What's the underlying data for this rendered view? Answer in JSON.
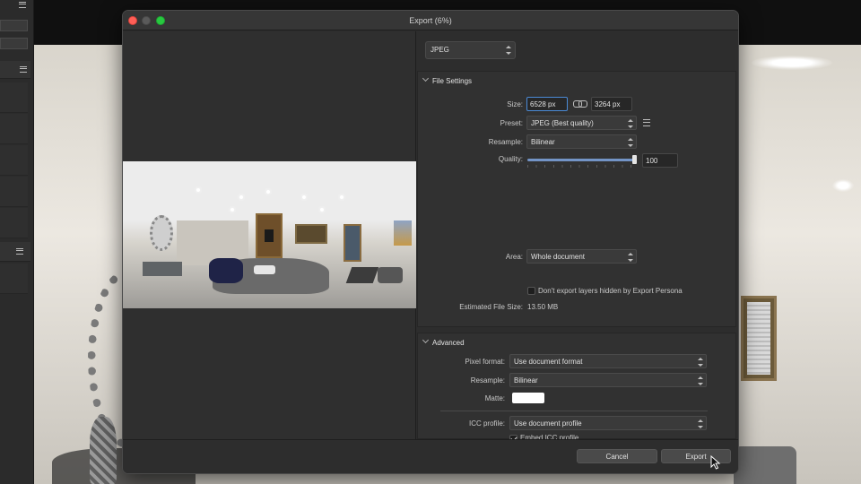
{
  "dialog": {
    "title": "Export (6%)",
    "format": {
      "value": "JPEG"
    }
  },
  "file_settings": {
    "header": "File Settings",
    "size_label": "Size:",
    "width_value": "6528 px",
    "height_value": "3264 px",
    "preset_label": "Preset:",
    "preset_value": "JPEG (Best quality)",
    "resample_label": "Resample:",
    "resample_value": "Bilinear",
    "quality_label": "Quality:",
    "quality_value": "100",
    "quality_level": 1.0,
    "area_label": "Area:",
    "area_value": "Whole document",
    "hidden_layers_label": "Don't export layers hidden by Export Persona",
    "estimated_label": "Estimated File Size:",
    "estimated_value": "13.50 MB"
  },
  "advanced": {
    "header": "Advanced",
    "pixel_format_label": "Pixel format:",
    "pixel_format_value": "Use document format",
    "resample_label": "Resample:",
    "resample_value": "Bilinear",
    "matte_label": "Matte:",
    "matte_color": "#ffffff",
    "icc_label": "ICC profile:",
    "icc_value": "Use document profile",
    "embed_icc_label": "Embed ICC profile"
  },
  "footer": {
    "cancel_label": "Cancel",
    "export_label": "Export"
  },
  "colors": {
    "accent": "#4b8ad6",
    "slider_fill": "#7394c6",
    "close": "#ff5f57",
    "maximize": "#28c840"
  },
  "icons": [
    "menu-icon",
    "link-icon",
    "chevron-down-icon",
    "list-icon",
    "pointer-cursor-icon"
  ]
}
